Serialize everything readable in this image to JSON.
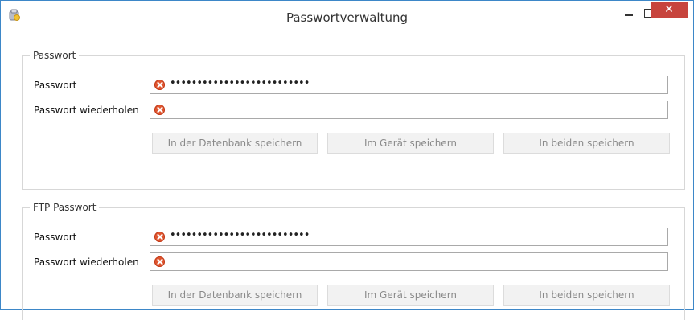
{
  "window": {
    "title": "Passwortverwaltung",
    "close_glyph": "✕",
    "icon": "app-icon",
    "accent_color": "#3d87c8",
    "close_color": "#c7443d"
  },
  "groups": [
    {
      "legend": "Passwort",
      "password_label": "Passwort",
      "password_value": "••••••••••••••••••••••••••",
      "repeat_label": "Passwort wiederholen",
      "repeat_value": "",
      "buttons": {
        "db": "In der Datenbank speichern",
        "device": "Im Gerät speichern",
        "both": "In beiden speichern"
      }
    },
    {
      "legend": "FTP Passwort",
      "password_label": "Passwort",
      "password_value": "••••••••••••••••••••••••••",
      "repeat_label": "Passwort wiederholen",
      "repeat_value": "",
      "buttons": {
        "db": "In der Datenbank speichern",
        "device": "Im Gerät speichern",
        "both": "In beiden speichern"
      }
    }
  ],
  "error_icon": "error-x-circle-icon",
  "error_color": "#e0552f"
}
